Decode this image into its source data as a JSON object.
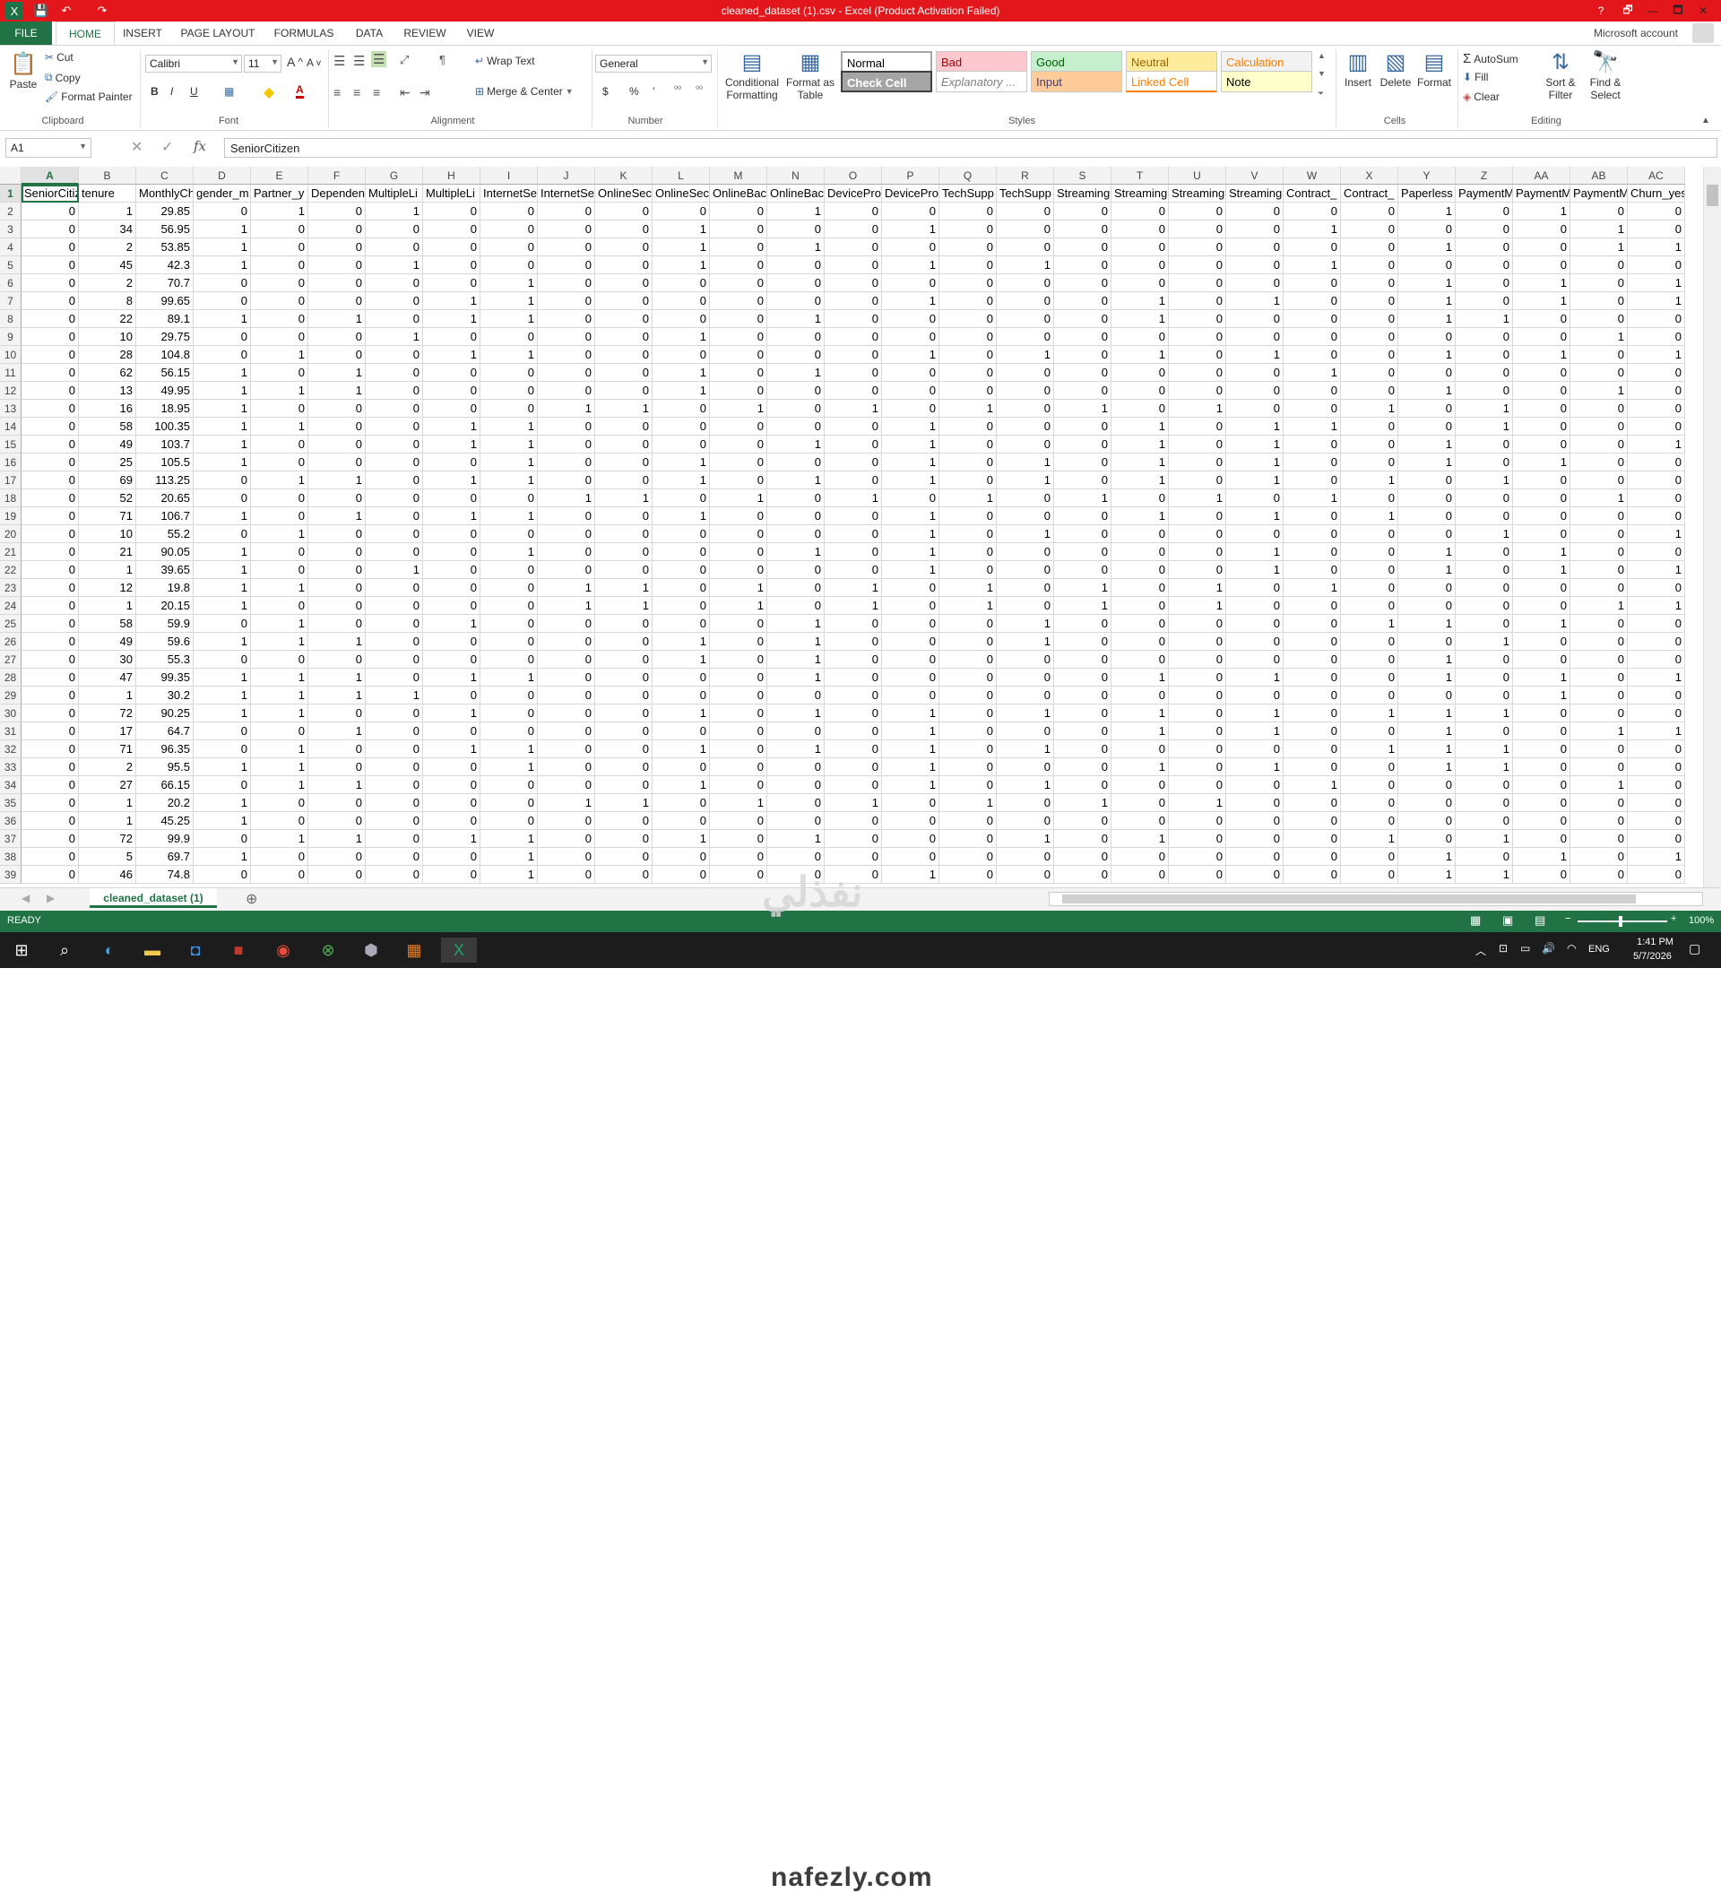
{
  "titlebar": {
    "title": "cleaned_dataset (1).csv -  Excel (Product Activation Failed)",
    "help": "?",
    "restore": "🗗",
    "minimize": "—",
    "maximize": "🗖",
    "close": "✕"
  },
  "quick_access": {
    "save": "💾",
    "undo": "↶",
    "redo": "↷"
  },
  "tabs": [
    "FILE",
    "HOME",
    "INSERT",
    "PAGE LAYOUT",
    "FORMULAS",
    "DATA",
    "REVIEW",
    "VIEW"
  ],
  "account": "Microsoft account",
  "ribbon": {
    "clipboard": {
      "label": "Clipboard",
      "paste": "Paste",
      "cut": "Cut",
      "copy": "Copy",
      "format_painter": "Format Painter"
    },
    "font": {
      "label": "Font",
      "name": "Calibri",
      "size": "11",
      "bold": "B",
      "italic": "I",
      "underline": "U"
    },
    "alignment": {
      "label": "Alignment",
      "wrap": "Wrap Text",
      "merge": "Merge & Center"
    },
    "number": {
      "label": "Number",
      "format": "General",
      "currency": "$",
      "percent": "%",
      "comma": "’"
    },
    "styles": {
      "label": "Styles",
      "conditional": "Conditional Formatting",
      "format_table": "Format as Table",
      "cells": [
        {
          "name": "Normal",
          "bg": "#ffffff",
          "fg": "#000000"
        },
        {
          "name": "Bad",
          "bg": "#ffc7ce",
          "fg": "#9c0006"
        },
        {
          "name": "Good",
          "bg": "#c6efce",
          "fg": "#006100"
        },
        {
          "name": "Neutral",
          "bg": "#ffeb9c",
          "fg": "#9c6500"
        },
        {
          "name": "Calculation",
          "bg": "#f2f2f2",
          "fg": "#fa7d00"
        },
        {
          "name": "Check Cell",
          "bg": "#a5a5a5",
          "fg": "#ffffff"
        },
        {
          "name": "Explanatory ...",
          "bg": "#ffffff",
          "fg": "#7f7f7f"
        },
        {
          "name": "Input",
          "bg": "#ffcc99",
          "fg": "#3f3f76"
        },
        {
          "name": "Linked Cell",
          "bg": "#ffffff",
          "fg": "#fa7d00"
        },
        {
          "name": "Note",
          "bg": "#ffffcc",
          "fg": "#000000"
        }
      ]
    },
    "cells": {
      "label": "Cells",
      "insert": "Insert",
      "delete": "Delete",
      "format": "Format"
    },
    "editing": {
      "label": "Editing",
      "autosum": "AutoSum",
      "fill": "Fill",
      "clear": "Clear",
      "sort": "Sort & Filter",
      "find": "Find & Select"
    }
  },
  "formula_bar": {
    "name_box": "A1",
    "fx": "fx",
    "content": "SeniorCitizen"
  },
  "columns": [
    "A",
    "B",
    "C",
    "D",
    "E",
    "F",
    "G",
    "H",
    "I",
    "J",
    "K",
    "L",
    "M",
    "N",
    "O",
    "P",
    "Q",
    "R",
    "S",
    "T",
    "U",
    "V",
    "W",
    "X",
    "Y",
    "Z",
    "AA",
    "AB",
    "AC"
  ],
  "headers": [
    "SeniorCitizen",
    "tenure",
    "MonthlyCharges",
    "gender_m",
    "Partner_y",
    "Dependents",
    "MultipleLi",
    "MultipleLi",
    "InternetSe",
    "InternetSe",
    "OnlineSec",
    "OnlineSec",
    "OnlineBac",
    "OnlineBac",
    "DevicePro",
    "DevicePro",
    "TechSupp",
    "TechSupp",
    "Streaming",
    "Streaming",
    "Streaming",
    "Streaming",
    "Contract_",
    "Contract_",
    "Paperless",
    "PaymentM",
    "PaymentM",
    "PaymentM",
    "Churn_yes"
  ],
  "rows": [
    [
      0,
      1,
      29.85,
      0,
      1,
      0,
      1,
      0,
      0,
      0,
      0,
      0,
      0,
      1,
      0,
      0,
      0,
      0,
      0,
      0,
      0,
      0,
      0,
      0,
      1,
      0,
      1,
      0,
      0
    ],
    [
      0,
      34,
      56.95,
      1,
      0,
      0,
      0,
      0,
      0,
      0,
      0,
      1,
      0,
      0,
      0,
      1,
      0,
      0,
      0,
      0,
      0,
      0,
      1,
      0,
      0,
      0,
      0,
      1,
      0
    ],
    [
      0,
      2,
      53.85,
      1,
      0,
      0,
      0,
      0,
      0,
      0,
      0,
      1,
      0,
      1,
      0,
      0,
      0,
      0,
      0,
      0,
      0,
      0,
      0,
      0,
      1,
      0,
      0,
      1,
      1
    ],
    [
      0,
      45,
      42.3,
      1,
      0,
      0,
      1,
      0,
      0,
      0,
      0,
      1,
      0,
      0,
      0,
      1,
      0,
      1,
      0,
      0,
      0,
      0,
      1,
      0,
      0,
      0,
      0,
      0,
      0
    ],
    [
      0,
      2,
      70.7,
      0,
      0,
      0,
      0,
      0,
      1,
      0,
      0,
      0,
      0,
      0,
      0,
      0,
      0,
      0,
      0,
      0,
      0,
      0,
      0,
      0,
      1,
      0,
      1,
      0,
      1
    ],
    [
      0,
      8,
      99.65,
      0,
      0,
      0,
      0,
      1,
      1,
      0,
      0,
      0,
      0,
      0,
      0,
      1,
      0,
      0,
      0,
      1,
      0,
      1,
      0,
      0,
      1,
      0,
      1,
      0,
      1
    ],
    [
      0,
      22,
      89.1,
      1,
      0,
      1,
      0,
      1,
      1,
      0,
      0,
      0,
      0,
      1,
      0,
      0,
      0,
      0,
      0,
      1,
      0,
      0,
      0,
      0,
      1,
      1,
      0,
      0,
      0
    ],
    [
      0,
      10,
      29.75,
      0,
      0,
      0,
      1,
      0,
      0,
      0,
      0,
      1,
      0,
      0,
      0,
      0,
      0,
      0,
      0,
      0,
      0,
      0,
      0,
      0,
      0,
      0,
      0,
      1,
      0
    ],
    [
      0,
      28,
      104.8,
      0,
      1,
      0,
      0,
      1,
      1,
      0,
      0,
      0,
      0,
      0,
      0,
      1,
      0,
      1,
      0,
      1,
      0,
      1,
      0,
      0,
      1,
      0,
      1,
      0,
      1
    ],
    [
      0,
      62,
      56.15,
      1,
      0,
      1,
      0,
      0,
      0,
      0,
      0,
      1,
      0,
      1,
      0,
      0,
      0,
      0,
      0,
      0,
      0,
      0,
      1,
      0,
      0,
      0,
      0,
      0,
      0
    ],
    [
      0,
      13,
      49.95,
      1,
      1,
      1,
      0,
      0,
      0,
      0,
      0,
      1,
      0,
      0,
      0,
      0,
      0,
      0,
      0,
      0,
      0,
      0,
      0,
      0,
      1,
      0,
      0,
      1,
      0
    ],
    [
      0,
      16,
      18.95,
      1,
      0,
      0,
      0,
      0,
      0,
      1,
      1,
      0,
      1,
      0,
      1,
      0,
      1,
      0,
      1,
      0,
      1,
      0,
      0,
      1,
      0,
      1,
      0,
      0,
      0
    ],
    [
      0,
      58,
      100.35,
      1,
      1,
      0,
      0,
      1,
      1,
      0,
      0,
      0,
      0,
      0,
      0,
      1,
      0,
      0,
      0,
      1,
      0,
      1,
      1,
      0,
      0,
      1,
      0,
      0,
      0
    ],
    [
      0,
      49,
      103.7,
      1,
      0,
      0,
      0,
      1,
      1,
      0,
      0,
      0,
      0,
      1,
      0,
      1,
      0,
      0,
      0,
      1,
      0,
      1,
      0,
      0,
      1,
      0,
      0,
      0,
      1
    ],
    [
      0,
      25,
      105.5,
      1,
      0,
      0,
      0,
      0,
      1,
      0,
      0,
      1,
      0,
      0,
      0,
      1,
      0,
      1,
      0,
      1,
      0,
      1,
      0,
      0,
      1,
      0,
      1,
      0,
      0
    ],
    [
      0,
      69,
      113.25,
      0,
      1,
      1,
      0,
      1,
      1,
      0,
      0,
      1,
      0,
      1,
      0,
      1,
      0,
      1,
      0,
      1,
      0,
      1,
      0,
      1,
      0,
      1,
      0,
      0,
      0
    ],
    [
      0,
      52,
      20.65,
      0,
      0,
      0,
      0,
      0,
      0,
      1,
      1,
      0,
      1,
      0,
      1,
      0,
      1,
      0,
      1,
      0,
      1,
      0,
      1,
      0,
      0,
      0,
      0,
      1,
      0
    ],
    [
      0,
      71,
      106.7,
      1,
      0,
      1,
      0,
      1,
      1,
      0,
      0,
      1,
      0,
      0,
      0,
      1,
      0,
      0,
      0,
      1,
      0,
      1,
      0,
      1,
      0,
      0,
      0,
      0,
      0
    ],
    [
      0,
      10,
      55.2,
      0,
      1,
      0,
      0,
      0,
      0,
      0,
      0,
      0,
      0,
      0,
      0,
      1,
      0,
      1,
      0,
      0,
      0,
      0,
      0,
      0,
      0,
      1,
      0,
      0,
      1
    ],
    [
      0,
      21,
      90.05,
      1,
      0,
      0,
      0,
      0,
      1,
      0,
      0,
      0,
      0,
      1,
      0,
      1,
      0,
      0,
      0,
      0,
      0,
      1,
      0,
      0,
      1,
      0,
      1,
      0,
      0
    ],
    [
      0,
      1,
      39.65,
      1,
      0,
      0,
      1,
      0,
      0,
      0,
      0,
      0,
      0,
      0,
      0,
      1,
      0,
      0,
      0,
      0,
      0,
      1,
      0,
      0,
      1,
      0,
      1,
      0,
      1
    ],
    [
      0,
      12,
      19.8,
      1,
      1,
      0,
      0,
      0,
      0,
      1,
      1,
      0,
      1,
      0,
      1,
      0,
      1,
      0,
      1,
      0,
      1,
      0,
      1,
      0,
      0,
      0,
      0,
      0,
      0
    ],
    [
      0,
      1,
      20.15,
      1,
      0,
      0,
      0,
      0,
      0,
      1,
      1,
      0,
      1,
      0,
      1,
      0,
      1,
      0,
      1,
      0,
      1,
      0,
      0,
      0,
      0,
      0,
      0,
      1,
      1
    ],
    [
      0,
      58,
      59.9,
      0,
      1,
      0,
      0,
      1,
      0,
      0,
      0,
      0,
      0,
      1,
      0,
      0,
      0,
      1,
      0,
      0,
      0,
      0,
      0,
      1,
      1,
      0,
      1,
      0,
      0
    ],
    [
      0,
      49,
      59.6,
      1,
      1,
      1,
      0,
      0,
      0,
      0,
      0,
      1,
      0,
      1,
      0,
      0,
      0,
      1,
      0,
      0,
      0,
      0,
      0,
      0,
      0,
      1,
      0,
      0,
      0
    ],
    [
      0,
      30,
      55.3,
      0,
      0,
      0,
      0,
      0,
      0,
      0,
      0,
      1,
      0,
      1,
      0,
      0,
      0,
      0,
      0,
      0,
      0,
      0,
      0,
      0,
      1,
      0,
      0,
      0,
      0
    ],
    [
      0,
      47,
      99.35,
      1,
      1,
      1,
      0,
      1,
      1,
      0,
      0,
      0,
      0,
      1,
      0,
      0,
      0,
      0,
      0,
      1,
      0,
      1,
      0,
      0,
      1,
      0,
      1,
      0,
      1
    ],
    [
      0,
      1,
      30.2,
      1,
      1,
      1,
      1,
      0,
      0,
      0,
      0,
      0,
      0,
      0,
      0,
      0,
      0,
      0,
      0,
      0,
      0,
      0,
      0,
      0,
      0,
      0,
      1,
      0,
      0
    ],
    [
      0,
      72,
      90.25,
      1,
      1,
      0,
      0,
      1,
      0,
      0,
      0,
      1,
      0,
      1,
      0,
      1,
      0,
      1,
      0,
      1,
      0,
      1,
      0,
      1,
      1,
      1,
      0,
      0,
      0
    ],
    [
      0,
      17,
      64.7,
      0,
      0,
      1,
      0,
      0,
      0,
      0,
      0,
      0,
      0,
      0,
      0,
      1,
      0,
      0,
      0,
      1,
      0,
      1,
      0,
      0,
      1,
      0,
      0,
      1,
      1
    ],
    [
      0,
      71,
      96.35,
      0,
      1,
      0,
      0,
      1,
      1,
      0,
      0,
      1,
      0,
      1,
      0,
      1,
      0,
      1,
      0,
      0,
      0,
      0,
      0,
      1,
      1,
      1,
      0,
      0,
      0
    ],
    [
      0,
      2,
      95.5,
      1,
      1,
      0,
      0,
      0,
      1,
      0,
      0,
      0,
      0,
      0,
      0,
      1,
      0,
      0,
      0,
      1,
      0,
      1,
      0,
      0,
      1,
      1,
      0,
      0,
      0
    ],
    [
      0,
      27,
      66.15,
      0,
      1,
      1,
      0,
      0,
      0,
      0,
      0,
      1,
      0,
      0,
      0,
      1,
      0,
      1,
      0,
      0,
      0,
      0,
      1,
      0,
      0,
      0,
      0,
      1,
      0
    ],
    [
      0,
      1,
      20.2,
      1,
      0,
      0,
      0,
      0,
      0,
      1,
      1,
      0,
      1,
      0,
      1,
      0,
      1,
      0,
      1,
      0,
      1,
      0,
      0,
      0,
      0,
      0,
      0,
      0,
      0
    ],
    [
      0,
      1,
      45.25,
      1,
      0,
      0,
      0,
      0,
      0,
      0,
      0,
      0,
      0,
      0,
      0,
      0,
      0,
      0,
      0,
      0,
      0,
      0,
      0,
      0,
      0,
      0,
      0,
      0,
      0
    ],
    [
      0,
      72,
      99.9,
      0,
      1,
      1,
      0,
      1,
      1,
      0,
      0,
      1,
      0,
      1,
      0,
      0,
      0,
      1,
      0,
      1,
      0,
      0,
      0,
      1,
      0,
      1,
      0,
      0,
      0
    ],
    [
      0,
      5,
      69.7,
      1,
      0,
      0,
      0,
      0,
      1,
      0,
      0,
      0,
      0,
      0,
      0,
      0,
      0,
      0,
      0,
      0,
      0,
      0,
      0,
      0,
      1,
      0,
      1,
      0,
      1
    ],
    [
      0,
      46,
      74.8,
      0,
      0,
      0,
      0,
      0,
      1,
      0,
      0,
      0,
      0,
      0,
      0,
      1,
      0,
      0,
      0,
      0,
      0,
      0,
      0,
      0,
      1,
      1,
      0,
      0,
      0
    ]
  ],
  "sheet_tab": "cleaned_dataset (1)",
  "status": {
    "ready": "READY",
    "zoom": "100%"
  },
  "taskbar": {
    "lang": "ENG",
    "time": "1:41 PM",
    "date": "5/7/2026"
  },
  "watermark": "nafezly.com",
  "watermark_ar": "نفذلي"
}
